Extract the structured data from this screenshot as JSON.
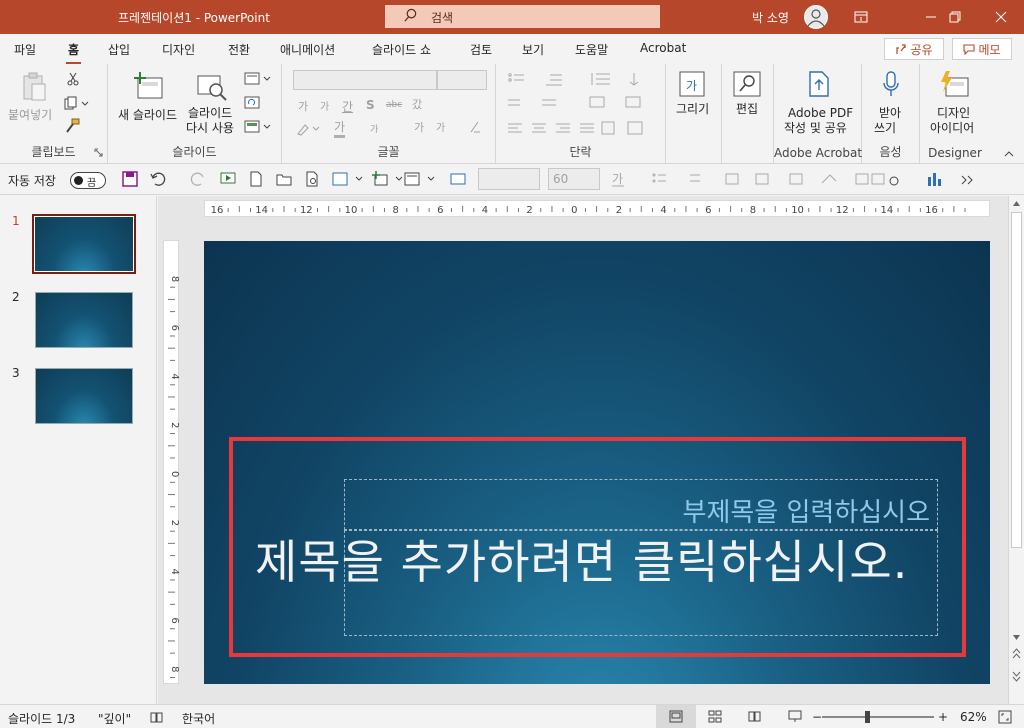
{
  "window": {
    "title": "프레젠테이션1  -  PowerPoint",
    "search_placeholder": "검색",
    "user": "박 소영"
  },
  "tabs": [
    "파일",
    "홈",
    "삽입",
    "디자인",
    "전환",
    "애니메이션",
    "슬라이드 쇼",
    "검토",
    "보기",
    "도움말",
    "Acrobat"
  ],
  "active_tab": "홈",
  "share_label": "공유",
  "comment_label": "메모",
  "ribbon": {
    "clipboard": {
      "paste": "붙여넣기",
      "group": "클립보드"
    },
    "slides": {
      "new_slide": "새 슬라이드",
      "reuse": "슬라이드 다시 사용",
      "reuse_line1": "슬라이드",
      "reuse_line2": "다시 사용",
      "group": "슬라이드"
    },
    "font": {
      "group": "글꼴",
      "glyphs": [
        "가",
        "가",
        "간",
        "S",
        "abc",
        "갔",
        "가",
        "가",
        "가",
        "가",
        "가"
      ]
    },
    "paragraph": {
      "group": "단락"
    },
    "drawing": {
      "label": "그리기"
    },
    "editing": {
      "label": "편집"
    },
    "adobe": {
      "line1": "Adobe PDF",
      "line2": "작성 및 공유",
      "group": "Adobe Acrobat"
    },
    "voice": {
      "line1": "받아",
      "line2": "쓰기",
      "group": "음성"
    },
    "designer": {
      "line1": "디자인",
      "line2": "아이디어",
      "group": "Designer"
    }
  },
  "qat": {
    "autosave": "자동 저장",
    "autosave_state": "끔",
    "font_size": "60"
  },
  "ruler": {
    "h_ticks": [
      "16",
      "14",
      "12",
      "10",
      "8",
      "6",
      "4",
      "2",
      "0",
      "2",
      "4",
      "6",
      "8",
      "10",
      "12",
      "14",
      "16"
    ],
    "v_ticks": [
      "8",
      "6",
      "4",
      "2",
      "0",
      "2",
      "4",
      "6",
      "8"
    ]
  },
  "slides": [
    {
      "number": "1"
    },
    {
      "number": "2"
    },
    {
      "number": "3"
    }
  ],
  "selected_slide": 1,
  "slide": {
    "subtitle": "부제목을 입력하십시오",
    "title": "제목을 추가하려면 클릭하십시오."
  },
  "status": {
    "slide_counter": "슬라이드 1/3",
    "theme": "\"깊이\"",
    "language": "한국어",
    "zoom": "62%",
    "zoom_level": 0.4
  },
  "colors": {
    "accent": "#b7472a",
    "highlight_box": "#e8383b"
  }
}
